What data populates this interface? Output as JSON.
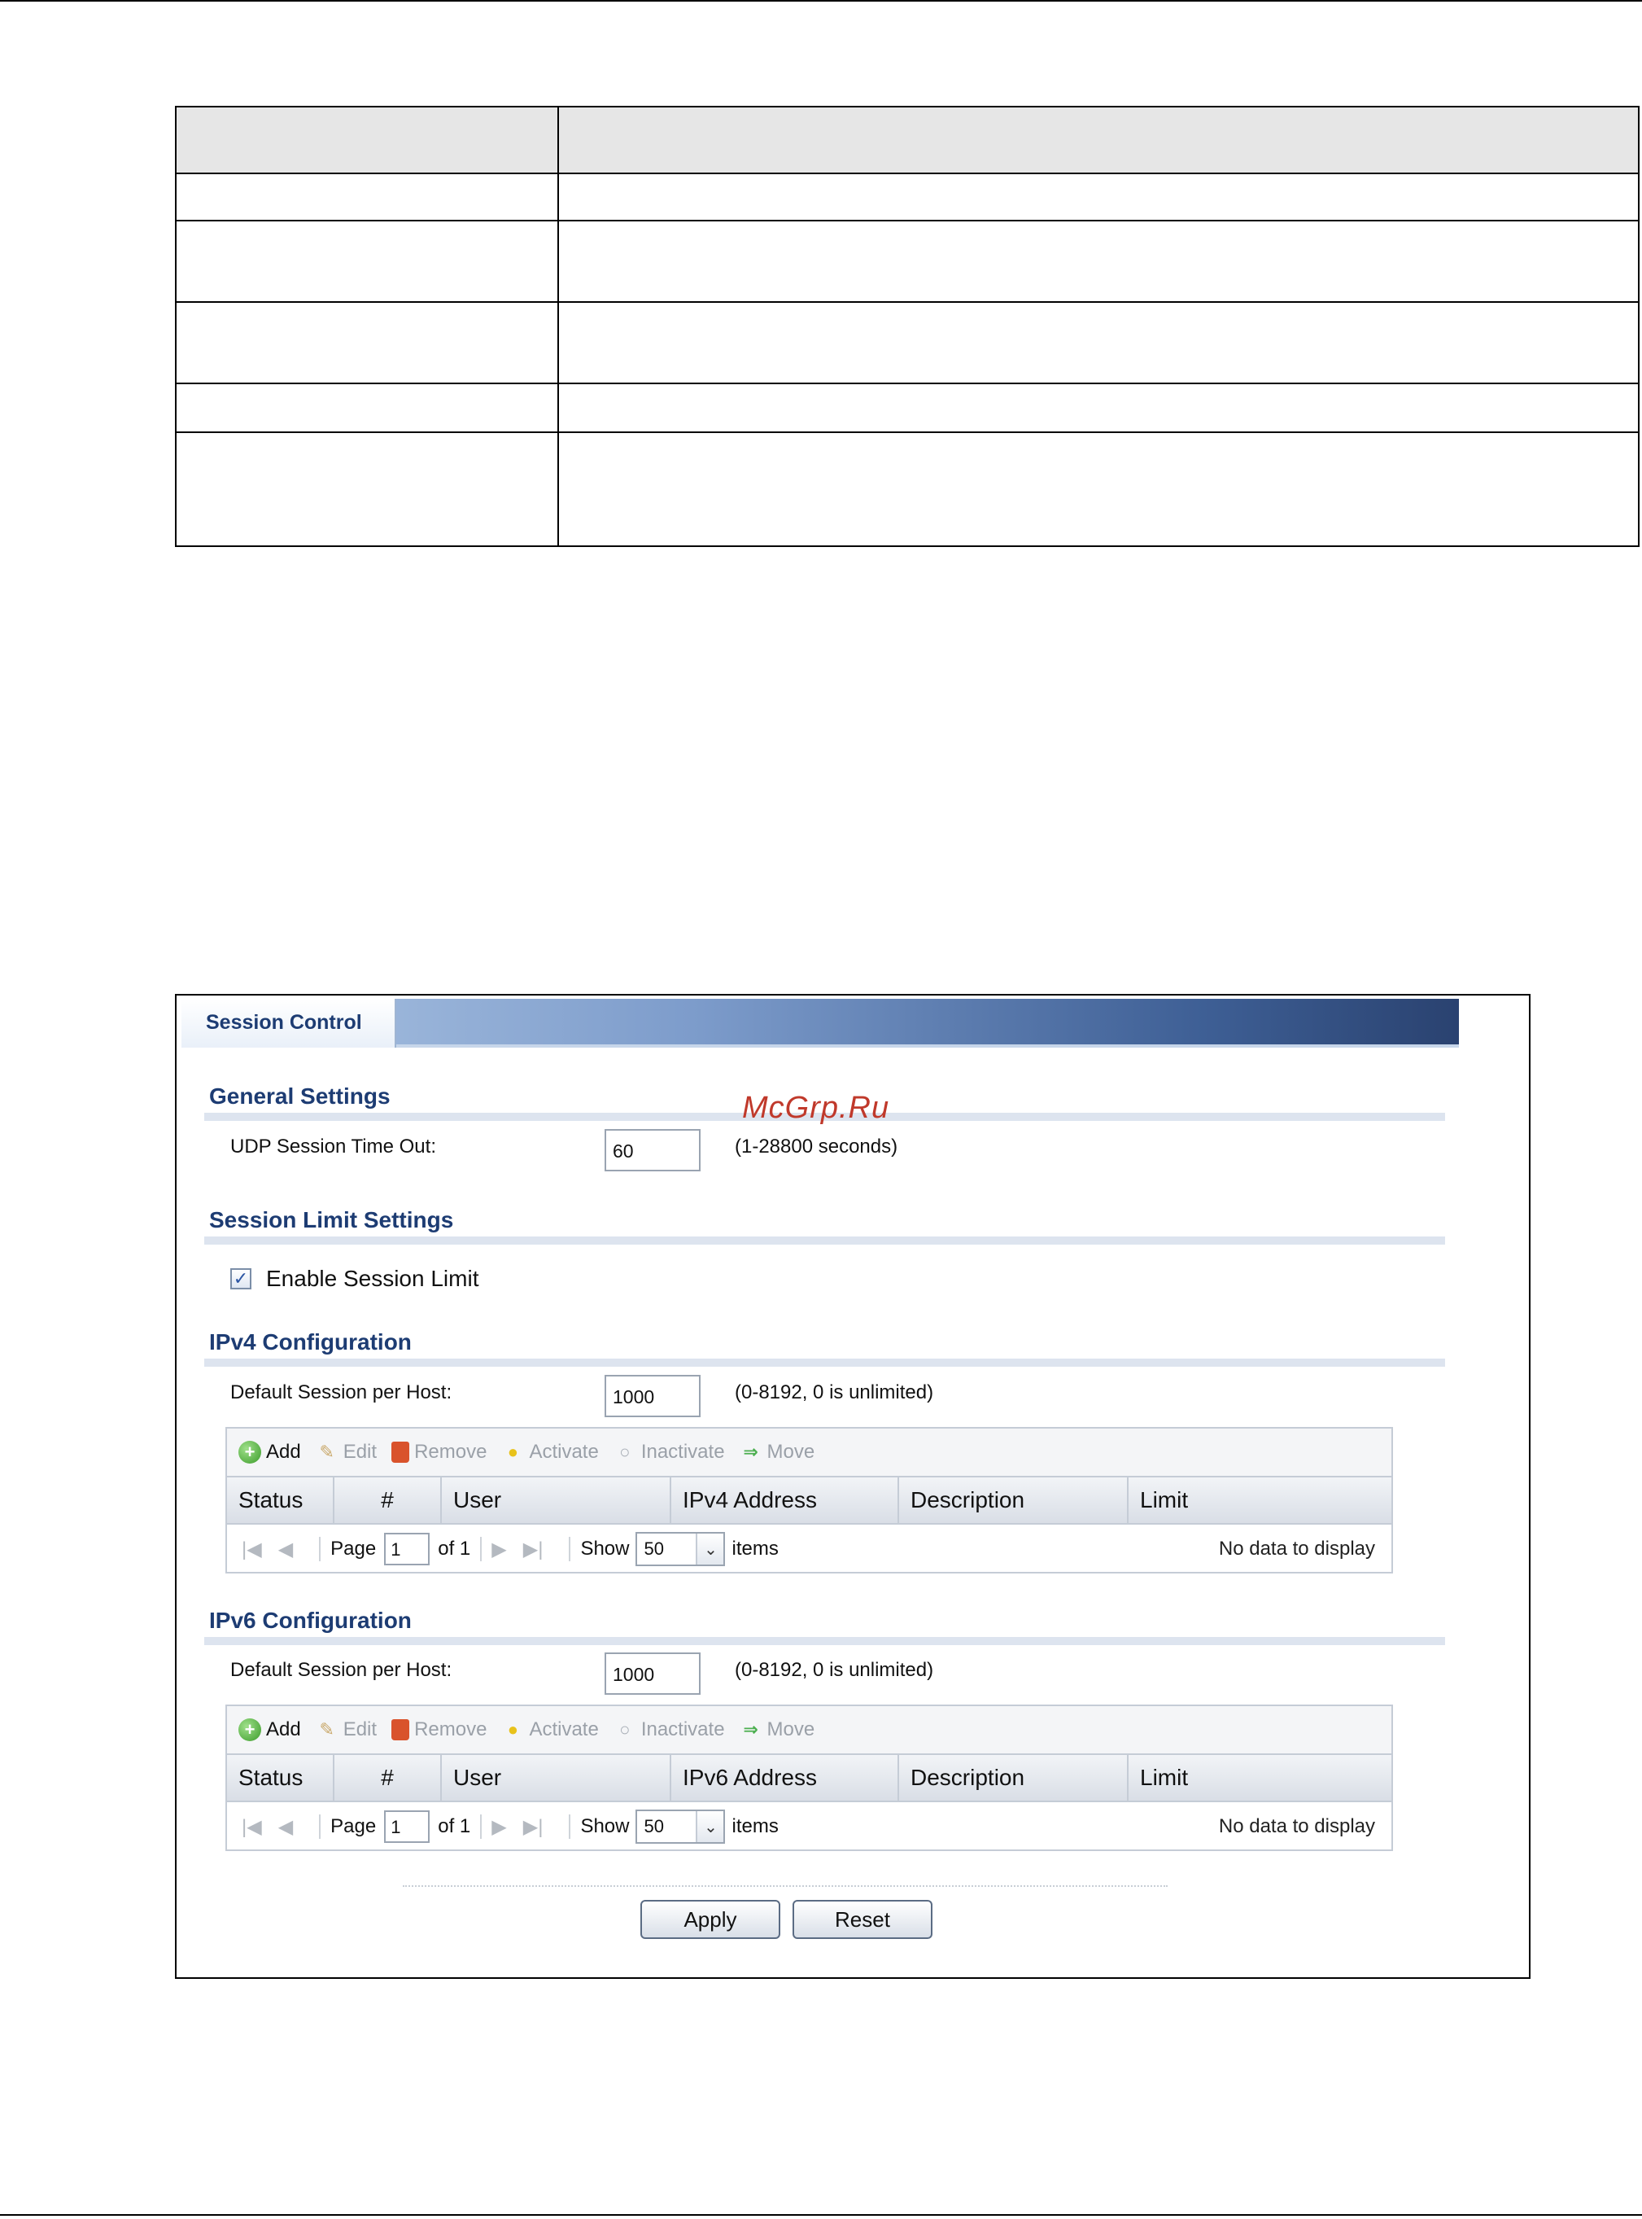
{
  "watermark": "McGrp.Ru",
  "doc_table": {
    "rows": 5
  },
  "screen": {
    "tab_label": "Session Control",
    "general": {
      "title": "General Settings",
      "udp_label": "UDP Session Time Out:",
      "udp_value": "60",
      "udp_hint": "(1-28800 seconds)"
    },
    "session_limit": {
      "title": "Session Limit Settings",
      "enable_label": "Enable Session Limit",
      "enabled": true
    },
    "toolbar": {
      "add": "Add",
      "edit": "Edit",
      "remove": "Remove",
      "activate": "Activate",
      "inactivate": "Inactivate",
      "move": "Move"
    },
    "pager": {
      "page_label": "Page",
      "page_value": "1",
      "of_label": "of 1",
      "show_label": "Show",
      "show_value": "50",
      "items_label": "items",
      "no_data": "No data to display"
    },
    "ipv4": {
      "title": "IPv4 Configuration",
      "default_label": "Default Session per Host:",
      "default_value": "1000",
      "default_hint": "(0-8192, 0 is unlimited)",
      "columns": [
        "Status",
        "#",
        "User",
        "IPv4 Address",
        "Description",
        "Limit"
      ]
    },
    "ipv6": {
      "title": "IPv6 Configuration",
      "default_label": "Default Session per Host:",
      "default_value": "1000",
      "default_hint": "(0-8192, 0 is unlimited)",
      "columns": [
        "Status",
        "#",
        "User",
        "IPv6 Address",
        "Description",
        "Limit"
      ]
    },
    "apply_label": "Apply",
    "reset_label": "Reset"
  },
  "icons": [
    "add-icon",
    "edit-icon",
    "remove-icon",
    "activate-icon",
    "inactivate-icon",
    "move-icon",
    "first-page-icon",
    "prev-page-icon",
    "next-page-icon",
    "last-page-icon",
    "chevron-down-icon",
    "checkmark-icon"
  ]
}
